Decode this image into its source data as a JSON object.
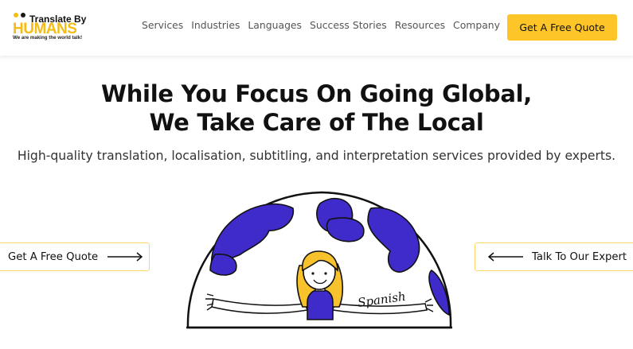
{
  "logo": {
    "title": "Translate By",
    "brand": "HUMANS",
    "tagline": "We are making the world talk!"
  },
  "nav": {
    "items": [
      {
        "label": "Services"
      },
      {
        "label": "Industries"
      },
      {
        "label": "Languages"
      },
      {
        "label": "Success Stories"
      },
      {
        "label": "Resources"
      },
      {
        "label": "Company"
      }
    ]
  },
  "header": {
    "cta_label": "Get A Free Quote"
  },
  "hero": {
    "title_line1": "While You Focus On Going Global,",
    "title_line2": "We Take Care of The Local",
    "subtitle": "High-quality translation, localisation, subtitling, and interpretation services provided by experts.",
    "left_button": "Get A Free Quote",
    "right_button": "Talk To Our Expert",
    "illustration_text": "Spanish"
  },
  "colors": {
    "accent": "#fdc528",
    "globe_land": "#3f2bc9",
    "text": "#111111"
  }
}
